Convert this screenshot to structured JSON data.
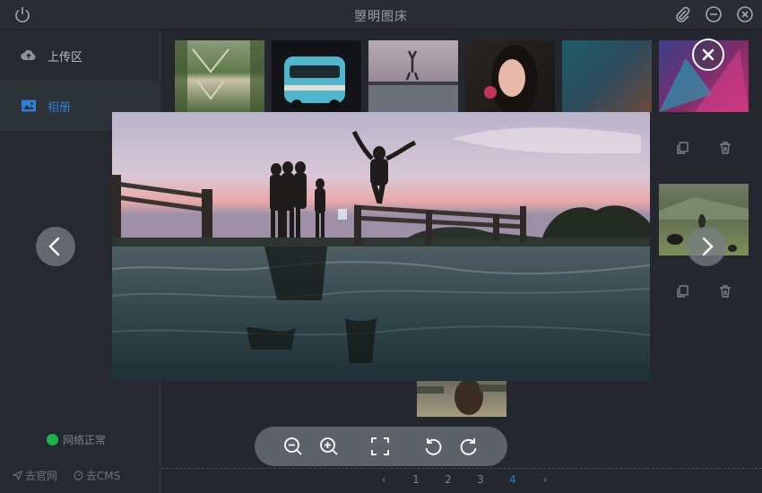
{
  "app": {
    "title": "曌明图床"
  },
  "sidebar": {
    "items": [
      {
        "label": "上传区",
        "icon": "cloud-upload-icon",
        "active": false
      },
      {
        "label": "相册",
        "icon": "image-icon",
        "active": true
      }
    ],
    "network_status": "网络正常",
    "status_color": "#1fb24a",
    "links": [
      {
        "label": "去官网",
        "icon": "send-icon"
      },
      {
        "label": "去CMS",
        "icon": "dashboard-icon"
      }
    ]
  },
  "pagination": {
    "prev": "‹",
    "pages": [
      "1",
      "2",
      "3",
      "4"
    ],
    "current": "4",
    "next": "›"
  },
  "viewer": {
    "tools": [
      "zoom-out-icon",
      "zoom-in-icon",
      "fit-screen-icon",
      "rotate-left-icon",
      "rotate-right-icon"
    ]
  },
  "colors": {
    "accent": "#2f7fd6",
    "background": "#23272e"
  }
}
